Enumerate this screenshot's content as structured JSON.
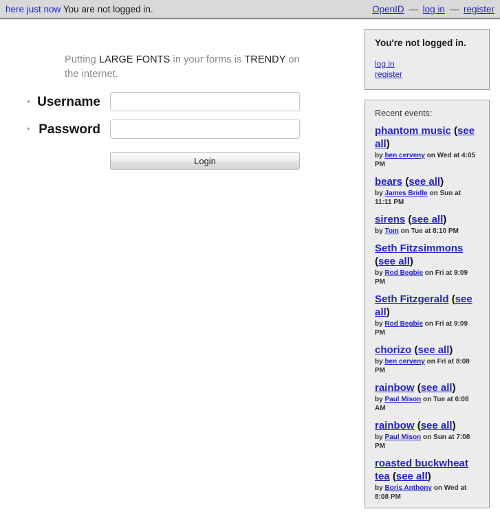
{
  "topbar": {
    "recent_link": "here just now",
    "status": "You are not logged in.",
    "openid_label": "OpenID",
    "login_label": "log in",
    "register_label": "register",
    "separator": "—"
  },
  "intro": {
    "part1": "Putting ",
    "emphasis1": "LARGE FONTS",
    "part2": " in your forms is ",
    "emphasis2": "TRENDY",
    "part3": " on the internet."
  },
  "form": {
    "required_marker": "*",
    "username_label": "Username",
    "username_value": "",
    "username_placeholder": "",
    "password_label": "Password",
    "password_value": "",
    "password_placeholder": "",
    "submit_label": "Login"
  },
  "sidebar": {
    "account_panel": {
      "title": "You're not logged in.",
      "login_label": "log in",
      "register_label": "register"
    },
    "events_panel": {
      "heading": "Recent events:",
      "see_all_label": "see all",
      "open_paren": "(",
      "close_paren": ")",
      "by_word": "by",
      "on_word": "on",
      "at_word": "at",
      "events": [
        {
          "title": "phantom music",
          "author": "ben cerveny",
          "day": "Wed",
          "time": "4:05 PM"
        },
        {
          "title": "bears",
          "author": "James Bridle",
          "day": "Sun",
          "time": "11:11 PM"
        },
        {
          "title": "sirens",
          "author": "Tom",
          "day": "Tue",
          "time": "8:10 PM"
        },
        {
          "title": "Seth Fitzsimmons",
          "author": "Rod Begbie",
          "day": "Fri",
          "time": "9:09 PM"
        },
        {
          "title": "Seth Fitzgerald",
          "author": "Rod Begbie",
          "day": "Fri",
          "time": "9:09 PM"
        },
        {
          "title": "chorizo",
          "author": "ben cerveny",
          "day": "Fri",
          "time": "8:08 PM"
        },
        {
          "title": "rainbow",
          "author": "Paul Mison",
          "day": "Tue",
          "time": "6:08 AM"
        },
        {
          "title": "rainbow",
          "author": "Paul Mison",
          "day": "Sun",
          "time": "7:08 PM"
        },
        {
          "title": "roasted buckwheat tea",
          "author": "Boris Anthony",
          "day": "Wed",
          "time": "8:08 PM"
        }
      ]
    }
  }
}
